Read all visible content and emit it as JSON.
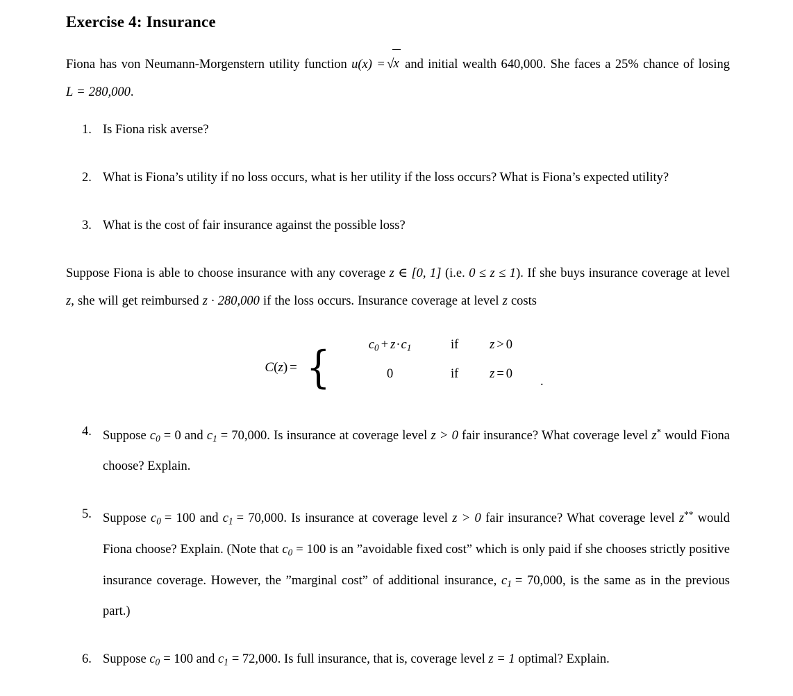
{
  "document": {
    "title": "Exercise 4:  Insurance",
    "title_text": "Exercise 4: Insurance",
    "intro": {
      "seg1": "Fiona has von Neumann-Morgenstern utility function ",
      "math_u": "u(x) =",
      "sqrt_sign": "√",
      "sqrt_radicand": "x",
      "seg2": " and initial wealth 640,000.  She faces a 25% chance of losing ",
      "math_L": "L = 280,000",
      "seg3": "."
    },
    "questions": [
      {
        "number": "1.",
        "text": "Is Fiona risk averse?"
      },
      {
        "number": "2.",
        "text": "What is Fiona’s utility if no loss occurs, what is her utility if the loss occurs?  What is Fiona’s expected utility?"
      },
      {
        "number": "3.",
        "text": "What is the cost of fair insurance against the possible loss?"
      }
    ],
    "coverage_paragraph": {
      "seg1": "Suppose Fiona is able to choose insurance with any coverage ",
      "math_z_interval": "z ∈ [0, 1]",
      "seg2": " (i.e. ",
      "math_z_range": "0 ≤ z ≤ 1",
      "seg3": ").  If she buys insurance coverage at level ",
      "math_z_a": "z",
      "seg4": ", she will get reimbursed ",
      "math_reimburse": "z · 280,000",
      "seg5": " if the loss occurs.  Insurance coverage at level ",
      "math_z_b": "z",
      "seg6": " costs"
    },
    "equation": {
      "lhs_fn": "C",
      "lhs_var": "z",
      "lhs_equals": "=",
      "brace_glyph": "{",
      "rows": [
        {
          "value_c0": "c",
          "value_c0_sub": "0",
          "value_plus": "+",
          "value_z": "z",
          "value_dot": "·",
          "value_c1": "c",
          "value_c1_sub": "1",
          "if_label": "if",
          "cond_var": "z",
          "cond_rel": ">",
          "cond_val": "0"
        },
        {
          "value_plain": "0",
          "if_label": "if",
          "cond_var": "z",
          "cond_rel": "=",
          "cond_val": "0"
        }
      ],
      "trailing_period": "."
    },
    "questions_cont": [
      {
        "number": "4.",
        "seg1": "Suppose ",
        "m_c0": "c",
        "m_c0_sub": "0",
        "m_eq1": "= 0",
        "seg2": " and ",
        "m_c1": "c",
        "m_c1_sub": "1",
        "m_eq2": "= 70,000",
        "seg3": ".  Is insurance at coverage level ",
        "m_z": "z > 0",
        "seg4": " fair insurance?  What coverage level ",
        "m_zstar": "z",
        "m_zstar_sup": "*",
        "seg5": " would Fiona choose?  Explain."
      },
      {
        "number": "5.",
        "seg1": "Suppose ",
        "m_c0": "c",
        "m_c0_sub": "0",
        "m_eq1": "= 100",
        "seg2": " and ",
        "m_c1": "c",
        "m_c1_sub": "1",
        "m_eq2": "= 70,000",
        "seg3": ".  Is insurance at coverage level ",
        "m_z": "z > 0",
        "seg4": " fair insurance?  What coverage level ",
        "m_zstar": "z",
        "m_zstar_sup": "**",
        "seg5": " would Fiona choose?  Explain.  (Note that ",
        "m_c0b": "c",
        "m_c0b_sub": "0",
        "m_eq3": "= 100",
        "seg6": " is an ”avoidable fixed cost” which is only paid if she chooses strictly positive insurance coverage.  However, the ”marginal cost” of additional insurance, ",
        "m_c1b": "c",
        "m_c1b_sub": "1",
        "m_eq4": "= 70,000",
        "seg7": ", is the same as in the previous part.)"
      },
      {
        "number": "6.",
        "seg1": "Suppose ",
        "m_c0": "c",
        "m_c0_sub": "0",
        "m_eq1": "= 100",
        "seg2": " and ",
        "m_c1": "c",
        "m_c1_sub": "1",
        "m_eq2": "= 72,000",
        "seg3": ".  Is full insurance, that is, coverage level ",
        "m_z": "z = 1",
        "seg4": " optimal?  Explain."
      }
    ]
  }
}
